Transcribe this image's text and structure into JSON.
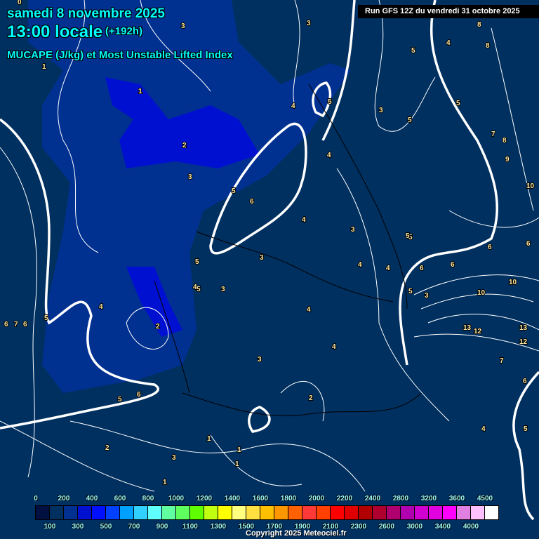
{
  "header": {
    "date": "samedi 8 novembre 2025",
    "time": "13:00 locale",
    "lead": "(+192h)",
    "parameter": "MUCAPE (J/kg) et Most Unstable Lifted Index",
    "run": "Run GFS 12Z du vendredi 31 octobre 2025"
  },
  "legend": {
    "values": [
      "0",
      "100",
      "200",
      "300",
      "400",
      "500",
      "600",
      "700",
      "800",
      "900",
      "1000",
      "1100",
      "1200",
      "1300",
      "1400",
      "1500",
      "1600",
      "1700",
      "1800",
      "1900",
      "2000",
      "2100",
      "2200",
      "2300",
      "2400",
      "2600",
      "2800",
      "3000",
      "3200",
      "3400",
      "3600",
      "4000",
      "4500"
    ],
    "colors": [
      "#001040",
      "#003060",
      "#003090",
      "#0010d0",
      "#0010ff",
      "#0040ff",
      "#00a0ff",
      "#30d0ff",
      "#60ffff",
      "#60ffa0",
      "#60ff60",
      "#60ff00",
      "#c0ff10",
      "#ffff00",
      "#ffff80",
      "#ffe040",
      "#ffc000",
      "#ff9800",
      "#ff6000",
      "#ff3838",
      "#ff4000",
      "#ff0000",
      "#e00000",
      "#b00000",
      "#b00030",
      "#b00070",
      "#b000b0",
      "#d000d0",
      "#e000e0",
      "#ff00ff",
      "#e080e0",
      "#ffc0ff",
      "#ffffff"
    ]
  },
  "contour_labels": [
    "0",
    "0",
    "1",
    "1",
    "2",
    "3",
    "3",
    "4",
    "5",
    "5",
    "6",
    "5",
    "4",
    "3",
    "4",
    "3",
    "5",
    "5",
    "3",
    "3",
    "4",
    "2",
    "4",
    "5",
    "6",
    "4",
    "7",
    "6",
    "5",
    "6",
    "3",
    "4",
    "2",
    "6",
    "5",
    "1",
    "1",
    "1",
    "3",
    "1",
    "2",
    "4",
    "5",
    "6",
    "6",
    "4",
    "6",
    "3",
    "10",
    "13",
    "12",
    "13",
    "12",
    "10",
    "8",
    "8",
    "7",
    "8",
    "9",
    "10",
    "5",
    "5",
    "4",
    "3",
    "7",
    "6",
    "4",
    "5",
    "5"
  ],
  "copyright": "Copyright 2025 Meteociel.fr"
}
